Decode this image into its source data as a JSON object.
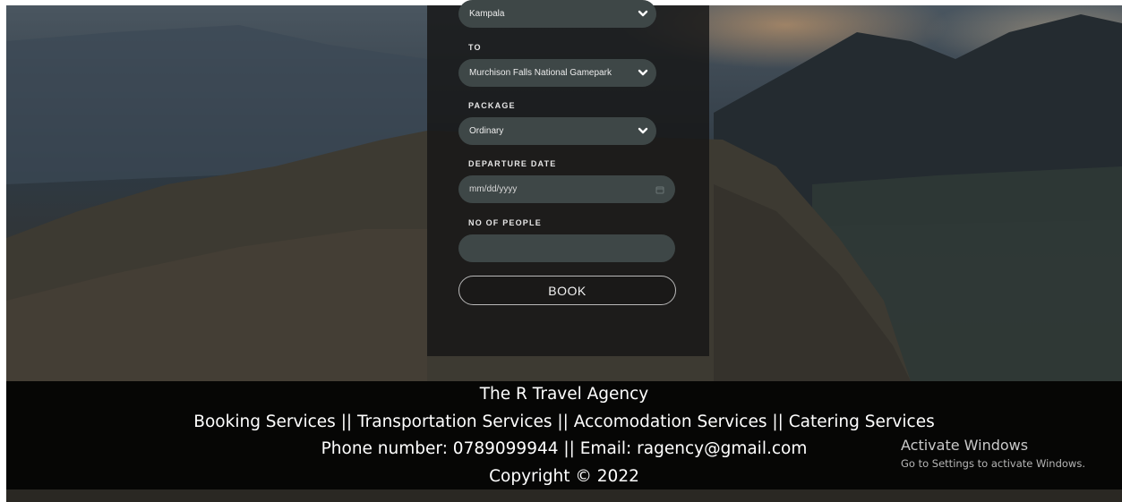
{
  "form": {
    "from_value": "Kampala",
    "to_label": "TO",
    "to_value": "Murchison Falls National Gamepark",
    "package_label": "PACKAGE",
    "package_value": "Ordinary",
    "departure_label": "DEPARTURE DATE",
    "departure_placeholder": "mm/dd/yyyy",
    "people_label": "NO OF PEOPLE",
    "people_value": "",
    "book_label": "BOOK"
  },
  "footer": {
    "agency_name": "The R Travel Agency",
    "services": "Booking Services || Transportation Services || Accomodation Services || Catering Services",
    "contact": "Phone number: 0789099944 || Email: ragency@gmail.com",
    "copyright": "Copyright © 2022"
  },
  "watermark": {
    "title": "Activate Windows",
    "subtitle": "Go to Settings to activate Windows."
  },
  "icons": {
    "dropdown": "chevron-down-icon",
    "date": "calendar-icon"
  },
  "colors": {
    "panel": "#161616",
    "control": "#3e4747",
    "footer": "#020202",
    "text": "#ffffff"
  }
}
